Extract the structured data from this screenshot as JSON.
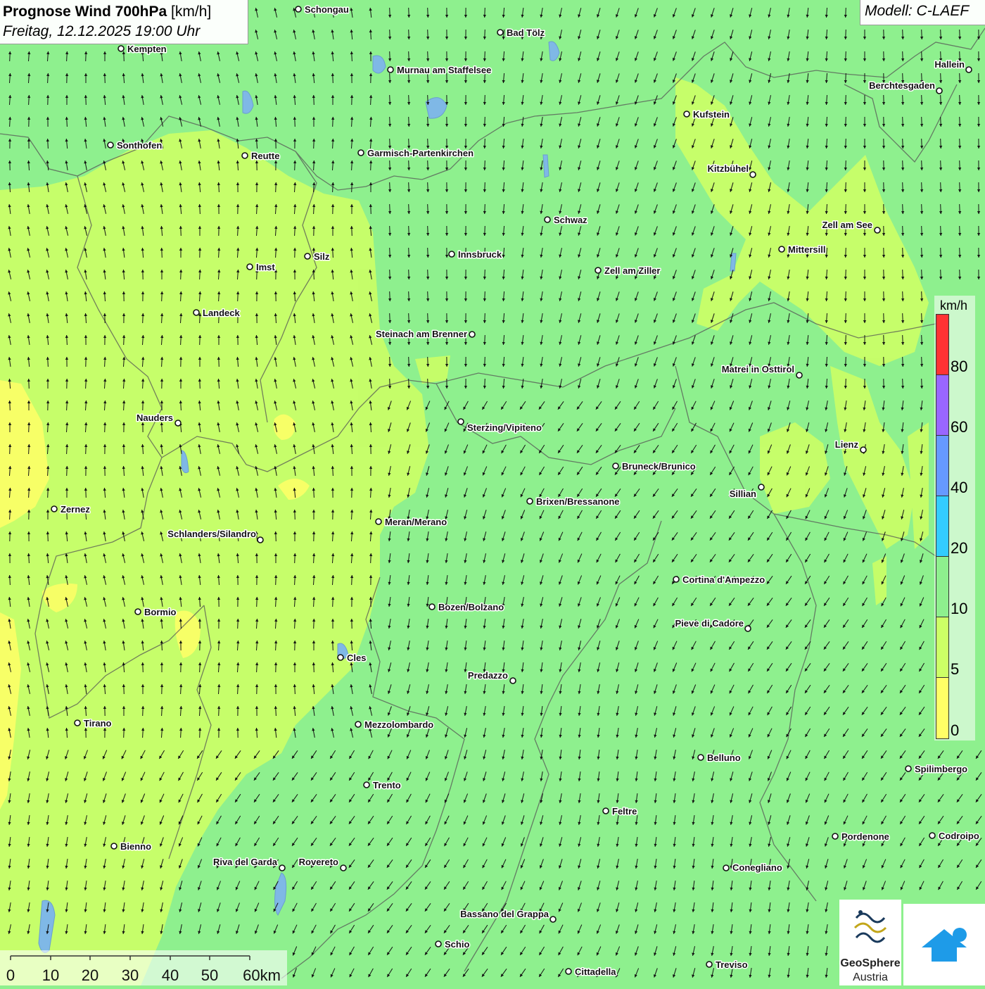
{
  "title": {
    "main": "Prognose Wind 700hPa",
    "unit": "[km/h]",
    "datetime": "Freitag, 12.12.2025 19:00 Uhr"
  },
  "model": "Modell: C-LAEF",
  "legend": {
    "unit": "km/h",
    "classes": [
      {
        "label": "0",
        "color": "#ffff66"
      },
      {
        "label": "5",
        "color": "#ccff66"
      },
      {
        "label": "10",
        "color": "#8ef08e"
      },
      {
        "label": "20",
        "color": "#33ccff"
      },
      {
        "label": "40",
        "color": "#6699ff"
      },
      {
        "label": "60",
        "color": "#9966ff"
      },
      {
        "label": "80",
        "color": "#ff3333"
      }
    ]
  },
  "scalebar": {
    "ticks": [
      "0",
      "10",
      "20",
      "30",
      "40",
      "50",
      "60km"
    ]
  },
  "logos": {
    "geosphere_line1": "GeoSphere",
    "geosphere_line2": "Austria"
  },
  "cities": [
    {
      "name": "Schongau"
    },
    {
      "name": "Bad Tölz"
    },
    {
      "name": "Kempten"
    },
    {
      "name": "Murnau am Staffelsee"
    },
    {
      "name": "Hallein"
    },
    {
      "name": "Berchtesgaden"
    },
    {
      "name": "Kufstein"
    },
    {
      "name": "Sonthofen"
    },
    {
      "name": "Reutte"
    },
    {
      "name": "Garmisch-Partenkirchen"
    },
    {
      "name": "Kitzbühel"
    },
    {
      "name": "Schwaz"
    },
    {
      "name": "Zell am See"
    },
    {
      "name": "Mittersill"
    },
    {
      "name": "Innsbruck"
    },
    {
      "name": "Silz"
    },
    {
      "name": "Imst"
    },
    {
      "name": "Zell am Ziller"
    },
    {
      "name": "Landeck"
    },
    {
      "name": "Steinach am Brenner"
    },
    {
      "name": "Matrei in Osttirol"
    },
    {
      "name": "Nauders"
    },
    {
      "name": "Sterzing/Vipiteno"
    },
    {
      "name": "Lienz"
    },
    {
      "name": "Bruneck/Brunico"
    },
    {
      "name": "Sillian"
    },
    {
      "name": "Brixen/Bressanone"
    },
    {
      "name": "Zernez"
    },
    {
      "name": "Meran/Merano"
    },
    {
      "name": "Schlanders/Silandro"
    },
    {
      "name": "Cortina d'Ampezzo"
    },
    {
      "name": "Bozen/Bolzano"
    },
    {
      "name": "Bormio"
    },
    {
      "name": "Pieve di Cadore"
    },
    {
      "name": "Cles"
    },
    {
      "name": "Predazzo"
    },
    {
      "name": "Tirano"
    },
    {
      "name": "Mezzolombardo"
    },
    {
      "name": "Belluno"
    },
    {
      "name": "Spilimbergo"
    },
    {
      "name": "Trento"
    },
    {
      "name": "Feltre"
    },
    {
      "name": "Pordenone"
    },
    {
      "name": "Codroipo"
    },
    {
      "name": "Bienno"
    },
    {
      "name": "Riva del Garda"
    },
    {
      "name": "Rovereto"
    },
    {
      "name": "Conegliano"
    },
    {
      "name": "Bassano del Grappa"
    },
    {
      "name": "Schio"
    },
    {
      "name": "Treviso"
    },
    {
      "name": "Cittadella"
    }
  ]
}
